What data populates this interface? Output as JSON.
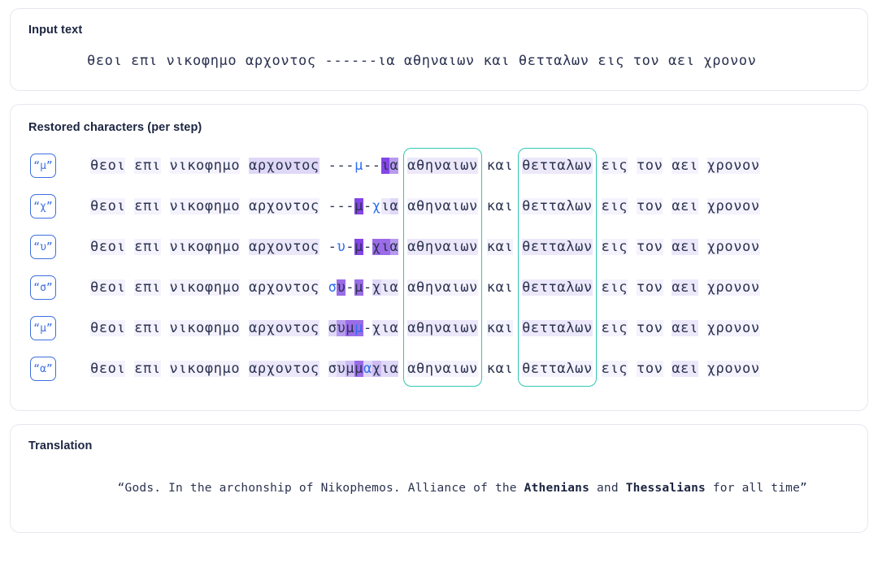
{
  "input_panel": {
    "title": "Input text",
    "text": "θεοι επι νικοφημο αρχοντος ------ια αθηναιων και θετταλων εις τον αει χρονον"
  },
  "steps_panel": {
    "title": "Restored characters (per step)",
    "prefix": "θεοι επι νικοφημο αρχοντος ",
    "suffix": " εις τον αει χρονον",
    "word_athenians": "αθηναιων",
    "word_kai": "και",
    "word_thessalians": "θετταλων",
    "steps": [
      {
        "badge": "“μ”",
        "restored_char": "μ",
        "gap": "---μ--ια",
        "gap_parts": [
          {
            "t": "---",
            "hl": 0,
            "new": false
          },
          {
            "t": "μ",
            "hl": 0,
            "new": true
          },
          {
            "t": "--",
            "hl": 0,
            "new": false
          },
          {
            "t": "ι",
            "hl": 7,
            "new": false
          },
          {
            "t": "α",
            "hl": 5,
            "new": false
          }
        ]
      },
      {
        "badge": "“χ”",
        "restored_char": "χ",
        "gap": "---μ-χια",
        "gap_parts": [
          {
            "t": "---",
            "hl": 0,
            "new": false
          },
          {
            "t": "μ",
            "hl": 7,
            "new": false
          },
          {
            "t": "-",
            "hl": 0,
            "new": false
          },
          {
            "t": "χ",
            "hl": 0,
            "new": true
          },
          {
            "t": "ι",
            "hl": 2,
            "new": false
          },
          {
            "t": "α",
            "hl": 3,
            "new": false
          }
        ]
      },
      {
        "badge": "“υ”",
        "restored_char": "υ",
        "gap": "-υ-μ-χια",
        "gap_parts": [
          {
            "t": "-",
            "hl": 0,
            "new": false
          },
          {
            "t": "υ",
            "hl": 0,
            "new": true
          },
          {
            "t": "-",
            "hl": 0,
            "new": false
          },
          {
            "t": "μ",
            "hl": 7,
            "new": false
          },
          {
            "t": "-",
            "hl": 0,
            "new": false
          },
          {
            "t": "χ",
            "hl": 6,
            "new": false
          },
          {
            "t": "ι",
            "hl": 6,
            "new": false
          },
          {
            "t": "α",
            "hl": 5,
            "new": false
          }
        ]
      },
      {
        "badge": "“σ”",
        "restored_char": "σ",
        "gap": "συ-μ-χια",
        "gap_parts": [
          {
            "t": "σ",
            "hl": 0,
            "new": true
          },
          {
            "t": "υ",
            "hl": 6,
            "new": false
          },
          {
            "t": "-",
            "hl": 0,
            "new": false
          },
          {
            "t": "μ",
            "hl": 6,
            "new": false
          },
          {
            "t": "-",
            "hl": 0,
            "new": false
          },
          {
            "t": "χ",
            "hl": 3,
            "new": false
          },
          {
            "t": "ι",
            "hl": 2,
            "new": false
          },
          {
            "t": "α",
            "hl": 2,
            "new": false
          }
        ]
      },
      {
        "badge": "“μ”",
        "restored_char": "μ",
        "gap": "συμμ-χια",
        "gap_parts": [
          {
            "t": "σ",
            "hl": 3,
            "new": false
          },
          {
            "t": "υ",
            "hl": 5,
            "new": false
          },
          {
            "t": "μ",
            "hl": 6,
            "new": false
          },
          {
            "t": "μ",
            "hl": 6,
            "new": true
          },
          {
            "t": "-",
            "hl": 0,
            "new": false
          },
          {
            "t": "χ",
            "hl": 2,
            "new": false
          },
          {
            "t": "ι",
            "hl": 2,
            "new": false
          },
          {
            "t": "α",
            "hl": 2,
            "new": false
          }
        ]
      },
      {
        "badge": "“α”",
        "restored_char": "α",
        "gap": "συμμαχια",
        "gap_parts": [
          {
            "t": "σ",
            "hl": 2,
            "new": false
          },
          {
            "t": "υ",
            "hl": 3,
            "new": false
          },
          {
            "t": "μ",
            "hl": 4,
            "new": false
          },
          {
            "t": "μ",
            "hl": 6,
            "new": false
          },
          {
            "t": "α",
            "hl": 3,
            "new": true
          },
          {
            "t": "χ",
            "hl": 4,
            "new": false
          },
          {
            "t": "ι",
            "hl": 3,
            "new": false
          },
          {
            "t": "α",
            "hl": 3,
            "new": false
          }
        ]
      }
    ],
    "prefix_highlights": [
      [
        {
          "t": "θεοι",
          "hl": 1
        },
        {
          "t": " ",
          "hl": 0
        },
        {
          "t": "επι",
          "hl": 1
        },
        {
          "t": " ",
          "hl": 0
        },
        {
          "t": "νικοφημο",
          "hl": 1
        },
        {
          "t": " ",
          "hl": 0
        },
        {
          "t": "αρχοντος",
          "hl": 3
        },
        {
          "t": " ",
          "hl": 0
        }
      ],
      [
        {
          "t": "θεοι",
          "hl": 1
        },
        {
          "t": " ",
          "hl": 0
        },
        {
          "t": "επι",
          "hl": 1
        },
        {
          "t": " ",
          "hl": 0
        },
        {
          "t": "νικοφημο",
          "hl": 1
        },
        {
          "t": " ",
          "hl": 0
        },
        {
          "t": "αρχοντος",
          "hl": 1
        },
        {
          "t": " ",
          "hl": 0
        }
      ],
      [
        {
          "t": "θεοι",
          "hl": 1
        },
        {
          "t": " ",
          "hl": 0
        },
        {
          "t": "επι",
          "hl": 1
        },
        {
          "t": " ",
          "hl": 0
        },
        {
          "t": "νικοφημο",
          "hl": 1
        },
        {
          "t": " ",
          "hl": 0
        },
        {
          "t": "αρχοντος",
          "hl": 2
        },
        {
          "t": " ",
          "hl": 0
        }
      ],
      [
        {
          "t": "θεοι",
          "hl": 1
        },
        {
          "t": " ",
          "hl": 0
        },
        {
          "t": "επι",
          "hl": 1
        },
        {
          "t": " ",
          "hl": 0
        },
        {
          "t": "νικοφημο",
          "hl": 1
        },
        {
          "t": " ",
          "hl": 0
        },
        {
          "t": "αρχοντος",
          "hl": 1
        },
        {
          "t": " ",
          "hl": 0
        }
      ],
      [
        {
          "t": "θεοι",
          "hl": 1
        },
        {
          "t": " ",
          "hl": 0
        },
        {
          "t": "επι",
          "hl": 1
        },
        {
          "t": " ",
          "hl": 0
        },
        {
          "t": "νικοφημο",
          "hl": 1
        },
        {
          "t": " ",
          "hl": 0
        },
        {
          "t": "αρχοντος",
          "hl": 2
        },
        {
          "t": " ",
          "hl": 0
        }
      ],
      [
        {
          "t": "θεοι",
          "hl": 1
        },
        {
          "t": " ",
          "hl": 0
        },
        {
          "t": "επι",
          "hl": 1
        },
        {
          "t": " ",
          "hl": 0
        },
        {
          "t": "νικοφημο",
          "hl": 1
        },
        {
          "t": " ",
          "hl": 0
        },
        {
          "t": "αρχοντος",
          "hl": 2
        },
        {
          "t": " ",
          "hl": 0
        }
      ]
    ],
    "suffix_highlights": [
      [
        {
          "t": " ",
          "hl": 0
        },
        {
          "t": "εις",
          "hl": 1
        },
        {
          "t": " ",
          "hl": 0
        },
        {
          "t": "τον",
          "hl": 1
        },
        {
          "t": " ",
          "hl": 0
        },
        {
          "t": "αει",
          "hl": 1
        },
        {
          "t": " ",
          "hl": 0
        },
        {
          "t": "χρονον",
          "hl": 1
        }
      ],
      [
        {
          "t": " ",
          "hl": 0
        },
        {
          "t": "εις",
          "hl": 1
        },
        {
          "t": " ",
          "hl": 0
        },
        {
          "t": "τον",
          "hl": 1
        },
        {
          "t": " ",
          "hl": 0
        },
        {
          "t": "αει",
          "hl": 1
        },
        {
          "t": " ",
          "hl": 0
        },
        {
          "t": "χρονον",
          "hl": 1
        }
      ],
      [
        {
          "t": " ",
          "hl": 0
        },
        {
          "t": "εις",
          "hl": 1
        },
        {
          "t": " ",
          "hl": 0
        },
        {
          "t": "τον",
          "hl": 1
        },
        {
          "t": " ",
          "hl": 0
        },
        {
          "t": "αει",
          "hl": 2
        },
        {
          "t": " ",
          "hl": 0
        },
        {
          "t": "χρονον",
          "hl": 1
        }
      ],
      [
        {
          "t": " ",
          "hl": 0
        },
        {
          "t": "εις",
          "hl": 1
        },
        {
          "t": " ",
          "hl": 0
        },
        {
          "t": "τον",
          "hl": 1
        },
        {
          "t": " ",
          "hl": 0
        },
        {
          "t": "αει",
          "hl": 2
        },
        {
          "t": " ",
          "hl": 0
        },
        {
          "t": "χρονον",
          "hl": 1
        }
      ],
      [
        {
          "t": " ",
          "hl": 0
        },
        {
          "t": "εις",
          "hl": 1
        },
        {
          "t": " ",
          "hl": 0
        },
        {
          "t": "τον",
          "hl": 1
        },
        {
          "t": " ",
          "hl": 0
        },
        {
          "t": "αει",
          "hl": 2
        },
        {
          "t": " ",
          "hl": 0
        },
        {
          "t": "χρονον",
          "hl": 1
        }
      ],
      [
        {
          "t": " ",
          "hl": 0
        },
        {
          "t": "εις",
          "hl": 1
        },
        {
          "t": " ",
          "hl": 0
        },
        {
          "t": "τον",
          "hl": 1
        },
        {
          "t": " ",
          "hl": 0
        },
        {
          "t": "αει",
          "hl": 2
        },
        {
          "t": " ",
          "hl": 0
        },
        {
          "t": "χρονον",
          "hl": 1
        }
      ]
    ],
    "mid_highlights": [
      {
        "ath": 2,
        "kai": 0,
        "thes": 2
      },
      {
        "ath": 1,
        "kai": 0,
        "thes": 1
      },
      {
        "ath": 2,
        "kai": 1,
        "thes": 2
      },
      {
        "ath": 1,
        "kai": 0,
        "thes": 2
      },
      {
        "ath": 2,
        "kai": 1,
        "thes": 2
      },
      {
        "ath": 1,
        "kai": 0,
        "thes": 1
      }
    ]
  },
  "translation_panel": {
    "title": "Translation",
    "text_open": "“Gods. In the archonship of Nikophemos. Alliance of the ",
    "bold_1": "Athenians",
    "text_mid": " and ",
    "bold_2": "Thessalians",
    "text_close": " for all time”"
  },
  "colors": {
    "panel_border": "#e6e8ef",
    "text": "#2b3350",
    "heading": "#1c2541",
    "badge_blue": "#3d6fe0",
    "new_char_blue": "#2f6df0",
    "teal_box": "#2fc7b4",
    "highlight_strong": "#8445e6"
  }
}
